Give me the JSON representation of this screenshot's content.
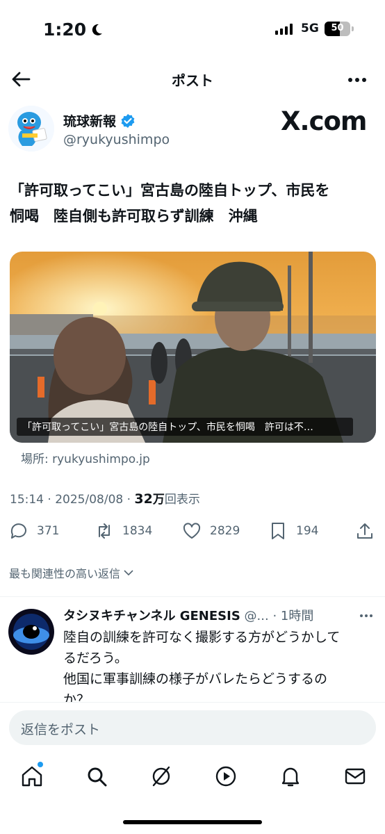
{
  "status": {
    "time": "1:20",
    "network": "5G",
    "battery": "50",
    "battery_fraction": 0.6
  },
  "nav": {
    "title": "ポスト"
  },
  "author": {
    "name": "琉球新報",
    "handle": "@ryukyushimpo",
    "site_logo": "X.com",
    "verified": true
  },
  "tweet": {
    "text": "「許可取ってこい」宮古島の陸自トップ、市民を\n恫喝　陸自側も許可取らず訓練　沖縄",
    "media_caption": "「許可取ってこい」宮古島の陸自トップ、市民を恫喝　許可は不…",
    "location": "場所: ryukyushimpo.jp",
    "time": "15:14",
    "date": "2025/08/08",
    "views_number": "32",
    "views_unit": "万",
    "views_label": "回表示",
    "sep": "·"
  },
  "actions": {
    "replies": "371",
    "reposts": "1834",
    "likes": "2829",
    "bookmarks": "194"
  },
  "sort": {
    "label": "最も関連性の高い返信"
  },
  "reply": {
    "name": "タシヌキチャンネル GENESIS",
    "handle": "@...",
    "sep": "·",
    "time": "1時間",
    "text": "陸自の訓練を許可なく撮影する方がどうかして\nるだろう。\n他国に軍事訓練の様子がバレたらどうするの\nか？"
  },
  "composer": {
    "placeholder": "返信をポスト"
  },
  "tabs": [
    "home-icon",
    "search-icon",
    "grok-icon",
    "video-icon",
    "notifications-icon",
    "messages-icon"
  ],
  "colors": {
    "accent": "#1d9bf0",
    "secondary_text": "#536471",
    "primary_text": "#0f1419"
  }
}
